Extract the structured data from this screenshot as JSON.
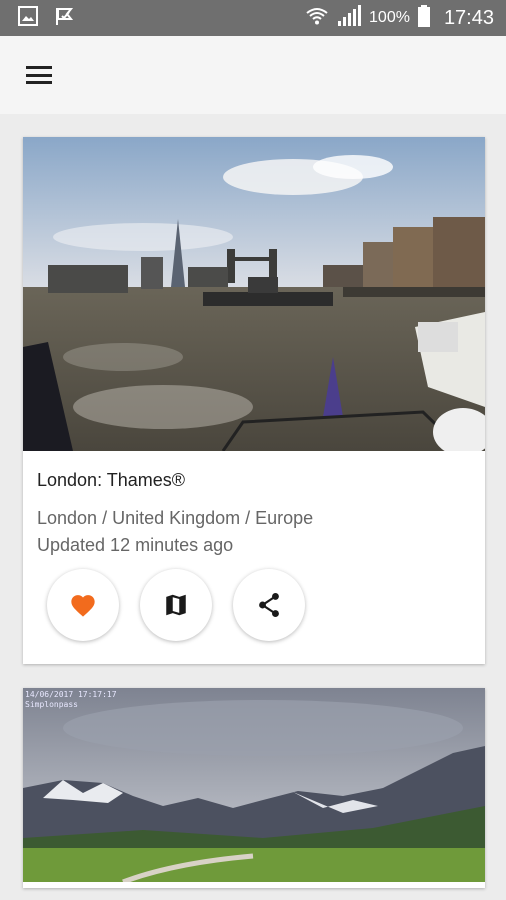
{
  "status_bar": {
    "battery_pct": "100%",
    "time": "17:43",
    "icons": [
      "gallery-icon",
      "flag-icon",
      "wifi-icon",
      "signal-icon",
      "battery-icon"
    ]
  },
  "app_bar": {
    "menu_icon": "hamburger-menu-icon"
  },
  "cards": [
    {
      "title": "London: Thames®",
      "location": "London / United Kingdom / Europe",
      "updated": "Updated 12 minutes ago",
      "actions": [
        "heart-icon",
        "map-icon",
        "share-icon"
      ],
      "accent_color": "#f26b1d"
    },
    {
      "stamp_line1": "14/06/2017 17:17:17",
      "stamp_line2": "Simplonpass"
    }
  ]
}
